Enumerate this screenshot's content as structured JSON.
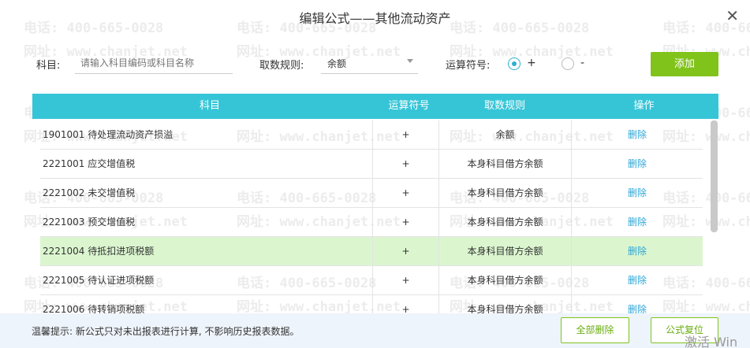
{
  "dialog": {
    "title": "编辑公式——其他流动资产",
    "close_icon": "close-icon"
  },
  "watermark": {
    "phone": "电话: 400-665-0028",
    "site": "网址: www.chanjet.net"
  },
  "filter": {
    "subject_label": "科目:",
    "subject_placeholder": "请输入科目编码或科目名称",
    "rule_label": "取数规则:",
    "rule_value": "余额",
    "operator_label": "运算符号:",
    "operator_plus": "+",
    "operator_minus": "-",
    "operator_selected": "+",
    "add_label": "添加"
  },
  "table": {
    "headers": [
      "科目",
      "运算符号",
      "取数规则",
      "操作"
    ],
    "rows": [
      {
        "subject": "1901001 待处理流动资产损溢",
        "op": "+",
        "rule": "余额",
        "action": "删除"
      },
      {
        "subject": "2221001 应交增值税",
        "op": "+",
        "rule": "本身科目借方余额",
        "action": "删除"
      },
      {
        "subject": "2221002 未交增值税",
        "op": "+",
        "rule": "本身科目借方余额",
        "action": "删除"
      },
      {
        "subject": "2221003 预交增值税",
        "op": "+",
        "rule": "本身科目借方余额",
        "action": "删除"
      },
      {
        "subject": "2221004 待抵扣进项税额",
        "op": "+",
        "rule": "本身科目借方余额",
        "action": "删除"
      },
      {
        "subject": "2221005 待认证进项税额",
        "op": "+",
        "rule": "本身科目借方余额",
        "action": "删除"
      },
      {
        "subject": "2221006 待转销项税额",
        "op": "+",
        "rule": "本身科目借方余额",
        "action": "删除"
      }
    ],
    "highlight_index": 4
  },
  "footer": {
    "tip": "温馨提示: 新公式只对未出报表进行计算, 不影响历史报表数据。",
    "delete_all_label": "全部删除",
    "reset_label": "公式复位"
  },
  "os_watermark": "激活 Win",
  "colors": {
    "header": "#36c5d7",
    "accent_green": "#80c31b",
    "link_blue": "#2ea6d6",
    "row_highlight": "#dbf6cf"
  }
}
